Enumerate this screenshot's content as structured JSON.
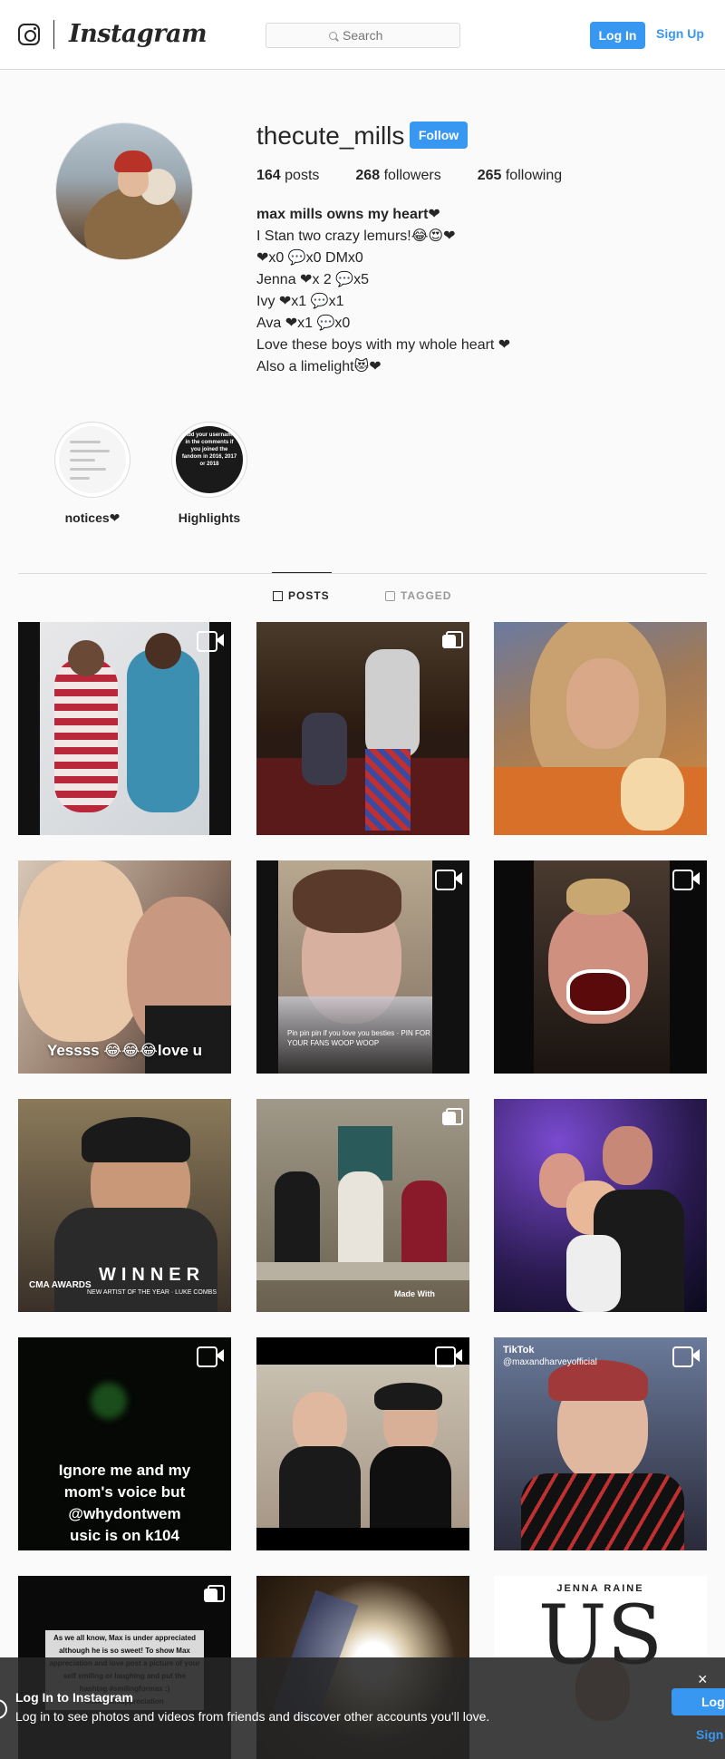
{
  "header": {
    "logo_text": "Instagram",
    "search_placeholder": "Search",
    "login_label": "Log In",
    "signup_label": "Sign Up",
    "accent_color": "#3897f0"
  },
  "profile": {
    "username": "thecute_mills",
    "follow_label": "Follow",
    "stats": [
      {
        "count": "164",
        "label": "posts"
      },
      {
        "count": "268",
        "label": "followers"
      },
      {
        "count": "265",
        "label": "following"
      }
    ],
    "bio_name": "max mills owns my heart❤",
    "bio_lines": [
      "I Stan two crazy lemurs!😂😍❤",
      "❤x0 💬x0 DMx0",
      "Jenna ❤x 2 💬x5",
      "Ivy ❤x1 💬x1",
      "Ava ❤x1 💬x0",
      "Love these boys with my whole heart ❤",
      "Also a limelight😻❤"
    ]
  },
  "highlights": [
    {
      "label": "notices❤"
    },
    {
      "label": "Highlights",
      "cover_text": "Add your username in the comments if you joined the fandom in 2016, 2017 or 2018"
    }
  ],
  "tabs": [
    {
      "label": "POSTS",
      "active": true
    },
    {
      "label": "TAGGED",
      "active": false
    }
  ],
  "posts": [
    {
      "badge": "video",
      "caption": ""
    },
    {
      "badge": "multi",
      "caption": ""
    },
    {
      "badge": "",
      "caption": ""
    },
    {
      "badge": "",
      "caption": "Yessss 😂😂😂love u"
    },
    {
      "badge": "video",
      "caption": "Pin pin pin if you love you besties · PIN FOR YOUR FANS WOOP WOOP"
    },
    {
      "badge": "video",
      "caption": ""
    },
    {
      "badge": "",
      "caption": "WINNER",
      "sub_caption": "NEW ARTIST OF THE YEAR · LUKE COMBS",
      "brand": "CMA AWARDS"
    },
    {
      "badge": "multi",
      "caption": "Made With"
    },
    {
      "badge": "",
      "caption": ""
    },
    {
      "badge": "video",
      "caption": "Ignore me and my mom's voice but @whydontwem usic is on k104"
    },
    {
      "badge": "video",
      "caption": ""
    },
    {
      "badge": "video",
      "caption": "@maxandharveyofficial",
      "brand": "TikTok"
    },
    {
      "badge": "multi",
      "caption": "As we all know, Max is under appreciated although he is so sweet! To show Max appreciation and love post a picture of your self smiling or laughing and put the hashtag #smilingformax :) #maxmillsappreciation"
    },
    {
      "badge": "",
      "caption": ""
    },
    {
      "badge": "",
      "caption": "JENNA RAINE",
      "sub_caption": "US"
    }
  ],
  "login_bar": {
    "title": "Log In to Instagram",
    "subtitle": "Log in to see photos and videos from friends and discover other accounts you'll love.",
    "button_label": "Log",
    "sign_label": "Sign",
    "close_glyph": "×"
  }
}
